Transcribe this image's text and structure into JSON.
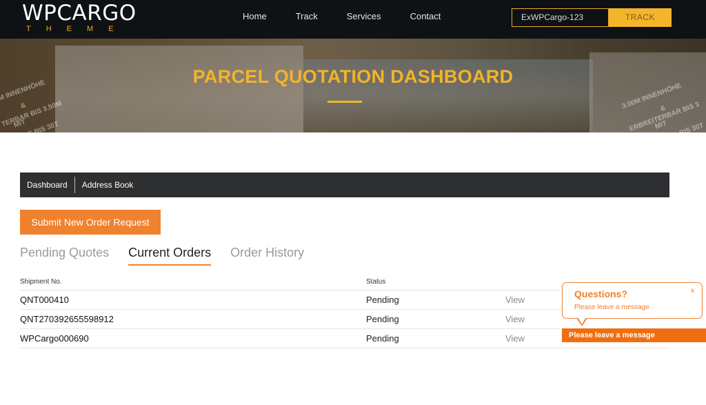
{
  "brand": {
    "name": "WPCARGO",
    "sub": "THEME",
    "accent": "#f3b429"
  },
  "nav": {
    "items": [
      "Home",
      "Track",
      "Services",
      "Contact"
    ]
  },
  "track": {
    "value": "ExWPCargo-123",
    "button": "TRACK"
  },
  "hero": {
    "title": "PARCEL QUOTATION DASHBOARD",
    "truck_text_left": [
      "M INNENHÖHE",
      "&",
      "TERBAR BIS 3.50M",
      "MIT",
      "E BIS 30T"
    ],
    "truck_text_right": [
      "3.00M INNENHÖHE",
      "&",
      "ERBREITERBAR BIS 3",
      "MIT",
      "R BIS 30T"
    ]
  },
  "subnav": {
    "items": [
      "Dashboard",
      "Address Book"
    ]
  },
  "submit_button": "Submit New Order Request",
  "tabs": [
    {
      "label": "Pending Quotes",
      "active": false
    },
    {
      "label": "Current Orders",
      "active": true
    },
    {
      "label": "Order History",
      "active": false
    }
  ],
  "table": {
    "headers": [
      "Shipment No.",
      "Status"
    ],
    "rows": [
      {
        "shipment": "QNT000410",
        "status": "Pending",
        "action": "View"
      },
      {
        "shipment": "QNT270392655598912",
        "status": "Pending",
        "action": "View"
      },
      {
        "shipment": "WPCargo000690",
        "status": "Pending",
        "action": "View"
      }
    ]
  },
  "chat": {
    "title": "Questions?",
    "subtitle": "Please leave a message",
    "close": "x",
    "bar": "Please leave a message",
    "color": "#f06e12"
  }
}
